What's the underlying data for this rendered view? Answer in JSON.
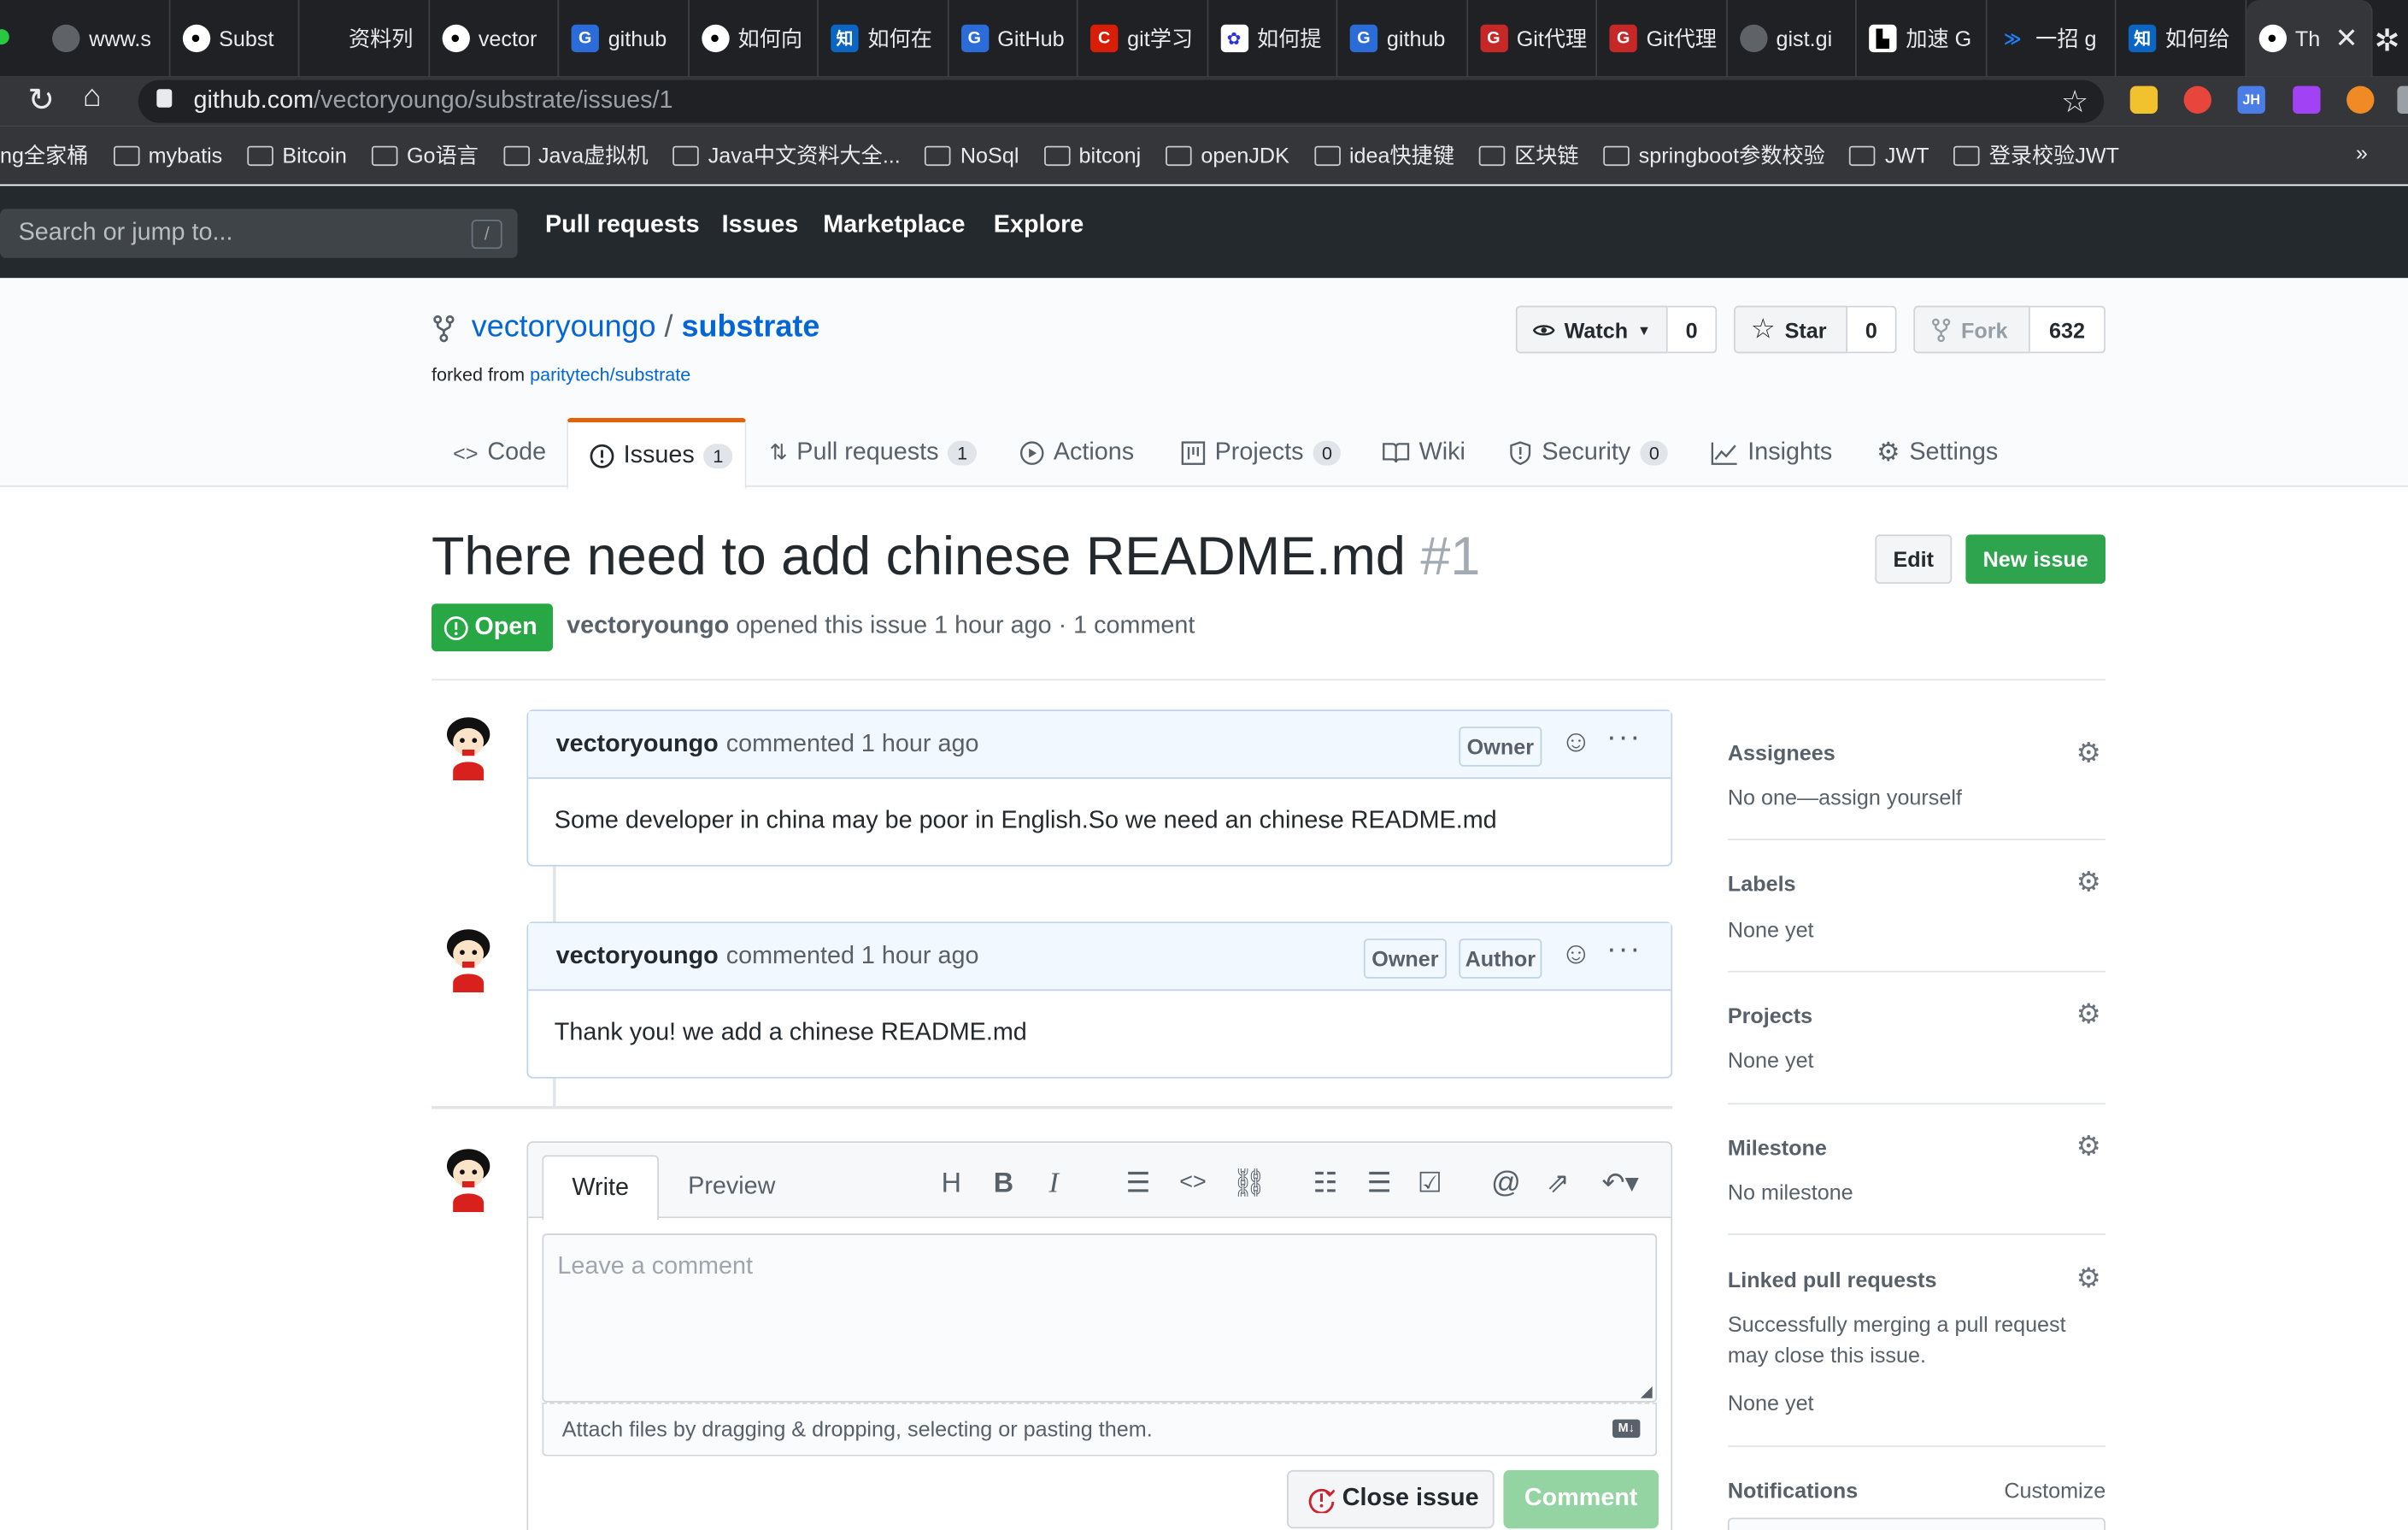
{
  "browser": {
    "tabs": [
      {
        "label": "www.s",
        "icon": "globe-icon"
      },
      {
        "label": "Subst",
        "icon": "github-icon"
      },
      {
        "label": "资料列",
        "icon": "blank-icon"
      },
      {
        "label": "vector",
        "icon": "github-icon"
      },
      {
        "label": "github",
        "icon": "bookmark-g-icon"
      },
      {
        "label": "如何向",
        "icon": "github-icon"
      },
      {
        "label": "如何在",
        "icon": "zhihu-icon"
      },
      {
        "label": "GitHub",
        "icon": "bookmark-g-icon"
      },
      {
        "label": "git学习",
        "icon": "csdn-icon"
      },
      {
        "label": "如何提",
        "icon": "baidu-icon"
      },
      {
        "label": "github",
        "icon": "bookmark-g-icon"
      },
      {
        "label": "Git代理",
        "icon": "g-red-icon"
      },
      {
        "label": "Git代理",
        "icon": "g-red-icon"
      },
      {
        "label": "gist.gi",
        "icon": "globe-icon"
      },
      {
        "label": "加速 G",
        "icon": "page-icon"
      },
      {
        "label": "一招 g",
        "icon": "juejin-icon"
      },
      {
        "label": "如何给",
        "icon": "zhihu-icon"
      },
      {
        "label": "Th",
        "icon": "github-icon",
        "active": true
      }
    ],
    "url_host": "github.com",
    "url_path": "/vectoryoungo/substrate/issues/1",
    "bookmarks": [
      "ng全家桶",
      "mybatis",
      "Bitcoin",
      "Go语言",
      "Java虚拟机",
      "Java中文资料大全...",
      "NoSql",
      "bitconj",
      "openJDK",
      "idea快捷键",
      "区块链",
      "springboot参数校验",
      "JWT",
      "登录校验JWT"
    ],
    "bookmarks_more": "»"
  },
  "gh_header": {
    "search_placeholder": "Search or jump to...",
    "search_key": "/",
    "nav": [
      "Pull requests",
      "Issues",
      "Marketplace",
      "Explore"
    ]
  },
  "repo": {
    "owner": "vectoryoungo",
    "sep": "/",
    "name": "substrate",
    "forked_prefix": "forked from",
    "forked_link": "paritytech/substrate",
    "watch_label": "Watch",
    "watch_count": "0",
    "star_label": "Star",
    "star_count": "0",
    "fork_label": "Fork",
    "fork_count": "632",
    "tabs": [
      {
        "label": "Code",
        "icon": "code-icon",
        "count": ""
      },
      {
        "label": "Issues",
        "icon": "issue-icon",
        "count": "1"
      },
      {
        "label": "Pull requests",
        "icon": "pull-request-icon",
        "count": "1"
      },
      {
        "label": "Actions",
        "icon": "play-icon",
        "count": ""
      },
      {
        "label": "Projects",
        "icon": "project-icon",
        "count": "0"
      },
      {
        "label": "Wiki",
        "icon": "book-icon",
        "count": ""
      },
      {
        "label": "Security",
        "icon": "shield-icon",
        "count": "0"
      },
      {
        "label": "Insights",
        "icon": "graph-icon",
        "count": ""
      },
      {
        "label": "Settings",
        "icon": "gear-icon",
        "count": ""
      }
    ]
  },
  "issue": {
    "title": "There need to add chinese README.md",
    "number": "#1",
    "edit_label": "Edit",
    "new_issue_label": "New issue",
    "state": "Open",
    "author": "vectoryoungo",
    "meta": "opened this issue 1 hour ago · 1 comment"
  },
  "comments": [
    {
      "author": "vectoryoungo",
      "meta": "commented 1 hour ago",
      "badges": [
        "Owner"
      ],
      "body": "Some developer in china may be poor in English.So we need an chinese README.md"
    },
    {
      "author": "vectoryoungo",
      "meta": "commented 1 hour ago",
      "badges": [
        "Owner",
        "Author"
      ],
      "body": "Thank you! we add a chinese README.md"
    }
  ],
  "composer": {
    "write_tab": "Write",
    "preview_tab": "Preview",
    "placeholder": "Leave a comment",
    "attach_hint": "Attach files by dragging & dropping, selecting or pasting them.",
    "close_label": "Close issue",
    "comment_label": "Comment"
  },
  "sidebar": {
    "assignees_title": "Assignees",
    "assignees_value": "No one—assign yourself",
    "labels_title": "Labels",
    "labels_value": "None yet",
    "projects_title": "Projects",
    "projects_value": "None yet",
    "milestone_title": "Milestone",
    "milestone_value": "No milestone",
    "linked_title": "Linked pull requests",
    "linked_desc1": "Successfully merging a pull request",
    "linked_desc2": "may close this issue.",
    "linked_value": "None yet",
    "notifications_title": "Notifications",
    "notifications_action": "Customize"
  },
  "colors": {
    "github_dark": "#24292e",
    "link": "#0366d6",
    "green": "#2ea44f",
    "open_green": "#28a745"
  }
}
